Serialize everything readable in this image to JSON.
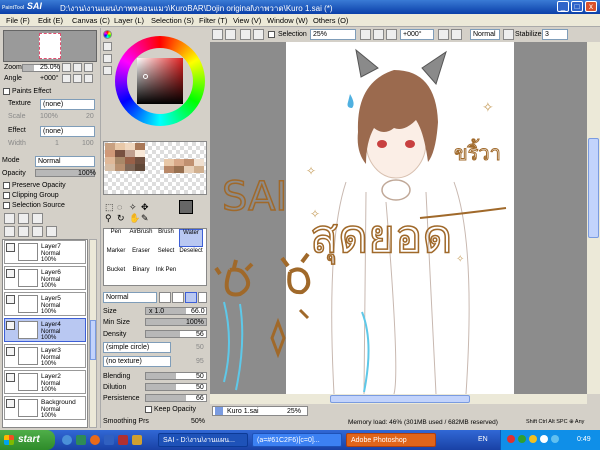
{
  "window": {
    "app": "SAI",
    "logo_small": "PaintTool",
    "title_path": "D:\\งาน\\งานแผน\\ภาพหลอนแมว\\KuroBAR\\Dojin original\\ภาพวาด\\Kuro 1.sai (*)",
    "min": "_",
    "max": "□",
    "close": "x"
  },
  "menu": [
    "File (F)",
    "Edit (E)",
    "Canvas (C)",
    "Layer (L)",
    "Selection (S)",
    "Filter (T)",
    "View (V)",
    "Window (W)",
    "Others (O)"
  ],
  "toolbar": {
    "selection_label": "Selection",
    "zoom": "25%",
    "angle": "+000°",
    "mode": "Normal",
    "stabilizer_label": "Stabilizer",
    "stabilizer": "3"
  },
  "navigator": {
    "zoom_label": "Zoom",
    "zoom_value": "25.0%",
    "angle_label": "Angle",
    "angle_value": "+000°"
  },
  "paper_effect": {
    "header": "Paints Effect",
    "texture_label": "Texture",
    "texture_value": "(none)",
    "scale_label": "Scale",
    "scale_value": "100%",
    "scale_num": "20",
    "effect_label": "Effect",
    "effect_value": "(none)",
    "width_label": "Width",
    "width_value": "1",
    "width_num": "100"
  },
  "layer_props": {
    "mode_label": "Mode",
    "mode_value": "Normal",
    "opacity_label": "Opacity",
    "opacity_value": "100%",
    "preserve_opacity": "Preserve Opacity",
    "clipping_group": "Clipping Group",
    "selection_source": "Selection Source"
  },
  "layers": [
    {
      "name": "Layer7",
      "mode": "Normal",
      "opacity": "100%",
      "selected": false
    },
    {
      "name": "Layer6",
      "mode": "Normal",
      "opacity": "100%",
      "selected": false
    },
    {
      "name": "Layer5",
      "mode": "Normal",
      "opacity": "100%",
      "selected": false
    },
    {
      "name": "Layer4",
      "mode": "Normal",
      "opacity": "100%",
      "selected": true
    },
    {
      "name": "Layer3",
      "mode": "Normal",
      "opacity": "100%",
      "selected": false
    },
    {
      "name": "Layer2",
      "mode": "Normal",
      "opacity": "100%",
      "selected": false
    },
    {
      "name": "Background",
      "mode": "Normal",
      "opacity": "100%",
      "selected": false
    }
  ],
  "tools": {
    "row1": [
      "Pen",
      "AirBrush",
      "Brush",
      "Water"
    ],
    "row2": [
      "Marker",
      "Eraser",
      "Select",
      "Deselect"
    ],
    "row3": [
      "Bucket",
      "Binary",
      "Ink Pen",
      ""
    ]
  },
  "brush": {
    "blend_mode": "Normal",
    "size_label": "Size",
    "size_mult": "x 1.0",
    "size_value": "66.0",
    "min_size_label": "Min Size",
    "min_size_value": "100%",
    "density_label": "Density",
    "density_value": "56",
    "shape": "(simple circle)",
    "shape_value": "50",
    "texture": "(no texture)",
    "texture_value": "95",
    "blending_label": "Blending",
    "blending_value": "50",
    "dilution_label": "Dilution",
    "dilution_value": "50",
    "persistence_label": "Persistence",
    "persistence_value": "66",
    "keep_opacity": "Keep Opacity",
    "smoothing_label": "Smoothing Prs",
    "smoothing_value": "50%"
  },
  "canvas_text": {
    "sai": "SAI",
    "thai1": "สุดยอด",
    "thai2": "ขริ้วา"
  },
  "file_tab": {
    "name": "Kuro 1.sai",
    "zoom": "25%"
  },
  "status": {
    "memory": "Memory load: 46% (301MB used / 682MB reserved)",
    "keys": "Shift Ctrl Alt SPC ⊕ Any"
  },
  "taskbar": {
    "start": "start",
    "tasks": [
      "SAI - D:\\งาน\\งานแผน...",
      "(a=#61C2F6)[c=0]...",
      "Adobe Photoshop"
    ],
    "lang": "EN",
    "time": "0:49"
  },
  "colors": {
    "accent": "#3a7bd5",
    "hair": "#8b5a3c",
    "drawing": "#a0692a",
    "cyan": "#5ec8e8",
    "palette": [
      "#c8a080",
      "#e8c8a8",
      "#f0d8c0",
      "#a87858",
      "#d09878",
      "#785040",
      "#c0a090",
      "#f8e8d8",
      "#e0b898",
      "#a88868",
      "#986048",
      "#705040",
      "#d8c0a8",
      "#b89070",
      "#806858",
      "#604838"
    ]
  }
}
